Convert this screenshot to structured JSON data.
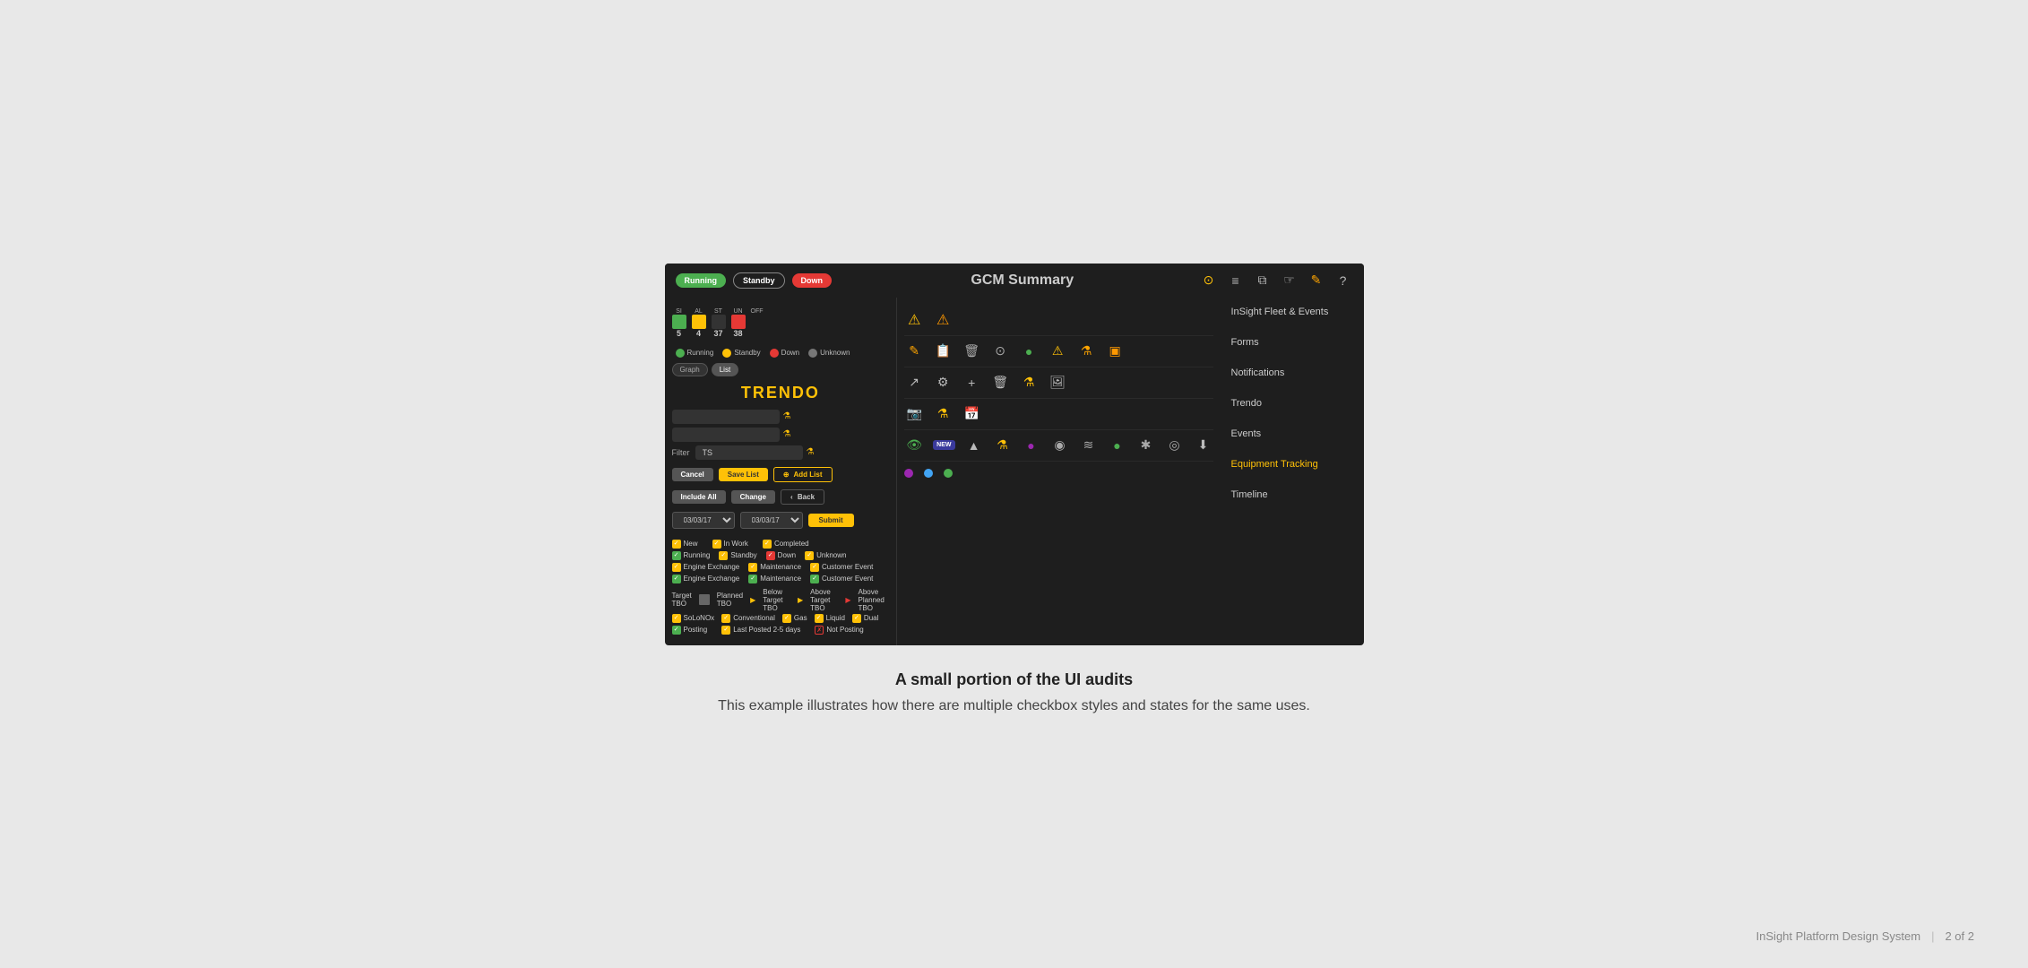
{
  "page": {
    "title": "GCM Summary",
    "background_color": "#e8e8e8"
  },
  "header": {
    "status_buttons": [
      {
        "label": "Running",
        "style": "running"
      },
      {
        "label": "Standby",
        "style": "standby"
      },
      {
        "label": "Down",
        "style": "down"
      }
    ],
    "title": "GCM Summary"
  },
  "stats": {
    "items": [
      {
        "label": "SI",
        "value": "5"
      },
      {
        "label": "AL",
        "value": "4"
      },
      {
        "label": "ST",
        "value": "37"
      },
      {
        "label": "UN",
        "value": "38"
      },
      {
        "label": "OFF",
        "value": ""
      }
    ]
  },
  "legend": {
    "items": [
      {
        "label": "Running",
        "color": "green"
      },
      {
        "label": "Standby",
        "color": "yellow"
      },
      {
        "label": "Down",
        "color": "red"
      },
      {
        "label": "Unknown",
        "color": "gray"
      }
    ]
  },
  "toggle": {
    "options": [
      "Graph",
      "List"
    ],
    "active": "List"
  },
  "trendo": {
    "title": "TRENDO"
  },
  "filters": {
    "filter_label": "Filter",
    "filter_value": "TS"
  },
  "action_buttons": {
    "cancel": "Cancel",
    "save_list": "Save List",
    "add_list": "Add List",
    "include_all": "Include All",
    "change": "Change",
    "back": "Back"
  },
  "dates": {
    "date1": "03/03/17",
    "date2": "03/03/17",
    "submit": "Submit"
  },
  "checkboxes": {
    "status_row1": [
      {
        "label": "New",
        "checked": true,
        "style": "yellow"
      },
      {
        "label": "In Work",
        "checked": true,
        "style": "yellow"
      },
      {
        "label": "Completed",
        "checked": true,
        "style": "yellow"
      }
    ],
    "status_row2": [
      {
        "label": "Running",
        "checked": true,
        "style": "green"
      },
      {
        "label": "Standby",
        "checked": true,
        "style": "yellow"
      },
      {
        "label": "Down",
        "checked": true,
        "style": "red"
      },
      {
        "label": "Unknown",
        "checked": true,
        "style": "yellow"
      }
    ],
    "event_row1": [
      {
        "label": "Engine Exchange",
        "checked": true,
        "style": "yellow"
      },
      {
        "label": "Maintenance",
        "checked": true,
        "style": "yellow"
      },
      {
        "label": "Customer Event",
        "checked": true,
        "style": "yellow"
      }
    ],
    "event_row2": [
      {
        "label": "Engine Exchange",
        "checked": true,
        "style": "green"
      },
      {
        "label": "Maintenance",
        "checked": true,
        "style": "green"
      },
      {
        "label": "Customer Event",
        "checked": true,
        "style": "green"
      }
    ],
    "tbo": {
      "target": "Target TBO",
      "planned": "Planned TBO",
      "below": "Below Target TBO",
      "above_target": "Above Target TBO",
      "above_planned": "Above Planned TBO"
    },
    "fuel_row": [
      {
        "label": "SoLoNOx",
        "checked": true,
        "style": "yellow"
      },
      {
        "label": "Conventional",
        "checked": true,
        "style": "yellow"
      },
      {
        "label": "Gas",
        "checked": true,
        "style": "yellow"
      },
      {
        "label": "Liquid",
        "checked": true,
        "style": "yellow"
      },
      {
        "label": "Dual",
        "checked": true,
        "style": "yellow"
      }
    ],
    "posting_row": [
      {
        "label": "Posting",
        "checked": true,
        "style": "yellow"
      },
      {
        "label": "Last Posted 2-5 days",
        "checked": true,
        "style": "yellow"
      },
      {
        "label": "Not Posting",
        "checked": false,
        "style": "red-x"
      }
    ]
  },
  "nav_links": [
    {
      "label": "InSight Fleet & Events",
      "active": false
    },
    {
      "label": "Forms",
      "active": false
    },
    {
      "label": "Notifications",
      "active": false
    },
    {
      "label": "Trendo",
      "active": false
    },
    {
      "label": "Events",
      "active": false
    },
    {
      "label": "Equipment Tracking",
      "active": true
    },
    {
      "label": "Timeline",
      "active": false
    }
  ],
  "footer": {
    "system_name": "InSight Platform Design System",
    "page_info": "2 of 2"
  },
  "caption": {
    "title": "A small portion of the UI audits",
    "subtitle": "This example illustrates how there are multiple checkbox styles and states for the same uses."
  },
  "icons": {
    "row1": [
      "⊙",
      "≡",
      "⧉",
      "☞",
      "📝",
      "?"
    ],
    "row2": [
      "⚠",
      "⚠"
    ],
    "row3": [
      "✏",
      "📋",
      "🗑",
      "⊙",
      "●",
      "⚠",
      "⚗",
      "📦"
    ],
    "row4": [
      "↗",
      "⚙",
      "+",
      "🗑",
      "⚗",
      "🖼"
    ],
    "row5": [
      "📷",
      "⚗",
      "📅"
    ],
    "row6": [
      "👁",
      "NEW",
      "▲",
      "⚗",
      "●",
      "◉",
      "≋",
      "●",
      "✱",
      "◎",
      "⬇"
    ]
  }
}
